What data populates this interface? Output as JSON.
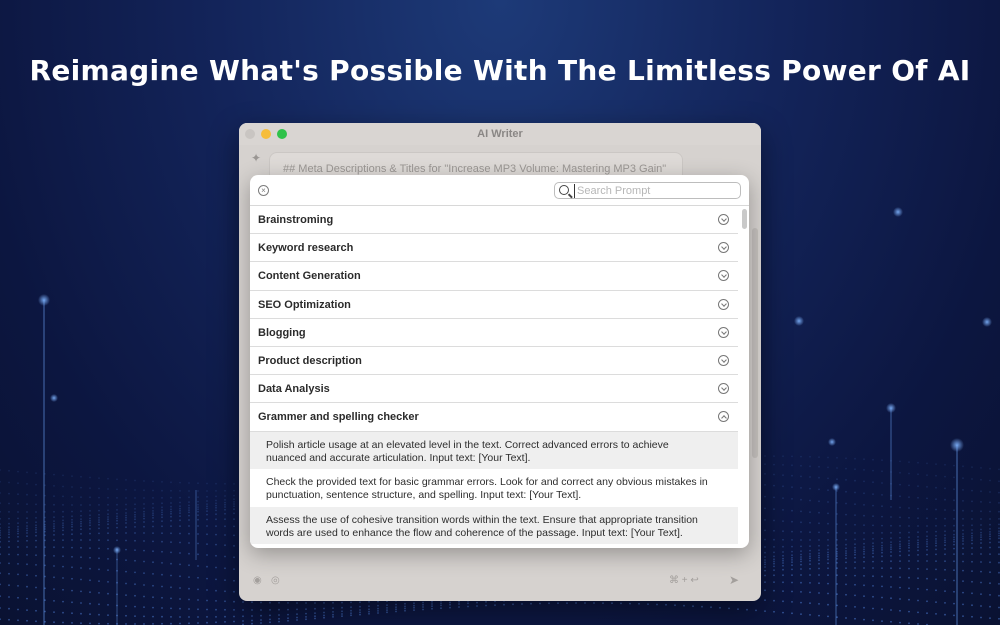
{
  "headline": "Reimagine What's Possible With The Limitless Power Of AI",
  "window": {
    "title": "AI Writer",
    "editor_text": "## Meta Descriptions & Titles for \"Increase MP3 Volume: Mastering MP3 Gain\""
  },
  "popup": {
    "search": {
      "placeholder": "Search Prompt",
      "value": ""
    },
    "categories": [
      {
        "label": "Brainstroming",
        "expanded": false
      },
      {
        "label": "Keyword research",
        "expanded": false
      },
      {
        "label": "Content Generation",
        "expanded": false
      },
      {
        "label": "SEO Optimization",
        "expanded": false
      },
      {
        "label": "Blogging",
        "expanded": false
      },
      {
        "label": "Product description",
        "expanded": false
      },
      {
        "label": "Data Analysis",
        "expanded": false
      },
      {
        "label": "Grammer and spelling checker",
        "expanded": true
      }
    ],
    "expanded_items": [
      {
        "line1": "Polish article usage at an elevated level in the text. Correct advanced errors to achieve",
        "line2": "nuanced and accurate articulation. Input text: [Your Text]."
      },
      {
        "line1": "Check the provided text for basic grammar errors. Look for and correct any obvious mistakes in",
        "line2": "punctuation, sentence structure, and spelling. Input text: [Your Text]."
      },
      {
        "line1": "Assess the use of cohesive transition words within the text. Ensure that appropriate transition",
        "line2": "words are used to enhance the flow and coherence of the passage. Input text: [Your Text]."
      }
    ]
  },
  "colors": {
    "background": "#13245a",
    "traffic_min": "#f6bd3b",
    "traffic_max": "#2fc24a"
  }
}
